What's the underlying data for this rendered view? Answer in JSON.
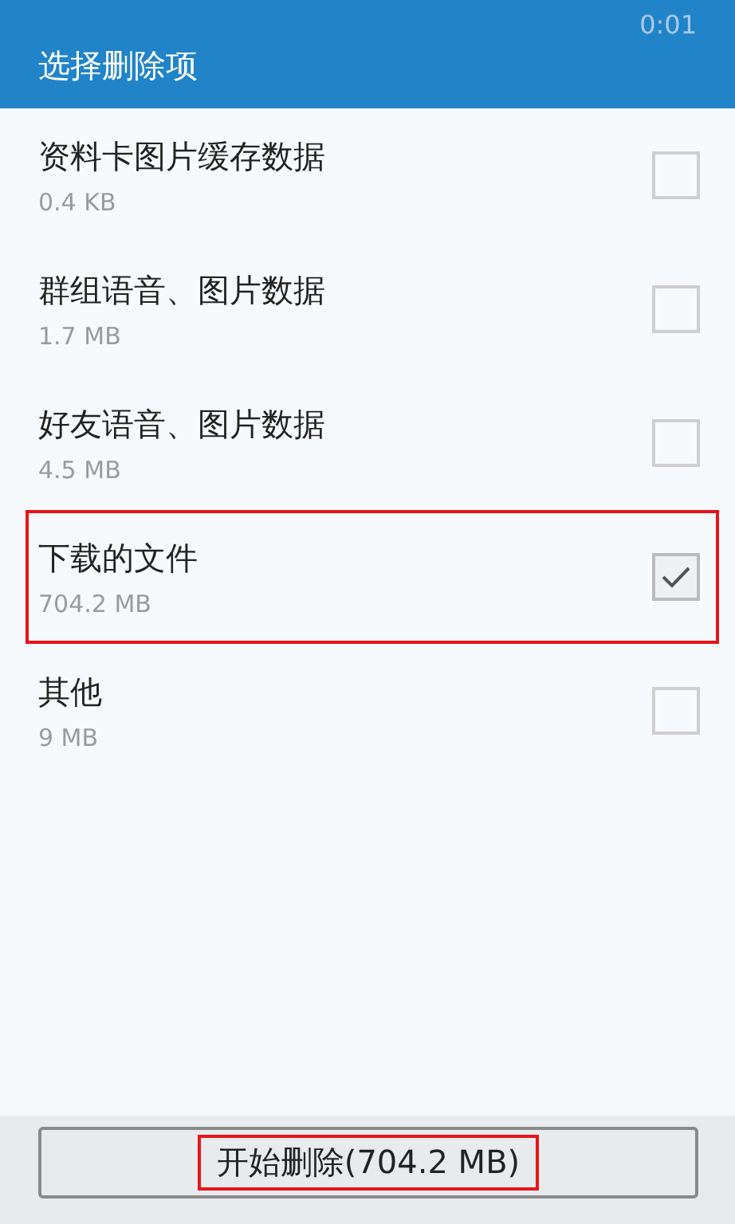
{
  "status_bar": {
    "time": "0:01"
  },
  "header": {
    "title": "选择删除项"
  },
  "items": [
    {
      "name": "资料卡图片缓存数据",
      "size": "0.4 KB",
      "checked": false,
      "highlighted": false
    },
    {
      "name": "群组语音、图片数据",
      "size": "1.7 MB",
      "checked": false,
      "highlighted": false
    },
    {
      "name": "好友语音、图片数据",
      "size": "4.5 MB",
      "checked": false,
      "highlighted": false
    },
    {
      "name": "下载的文件",
      "size": "704.2 MB",
      "checked": true,
      "highlighted": true
    },
    {
      "name": "其他",
      "size": "9 MB",
      "checked": false,
      "highlighted": false
    }
  ],
  "delete_button": {
    "label": "开始删除(704.2 MB)",
    "highlighted": true
  }
}
